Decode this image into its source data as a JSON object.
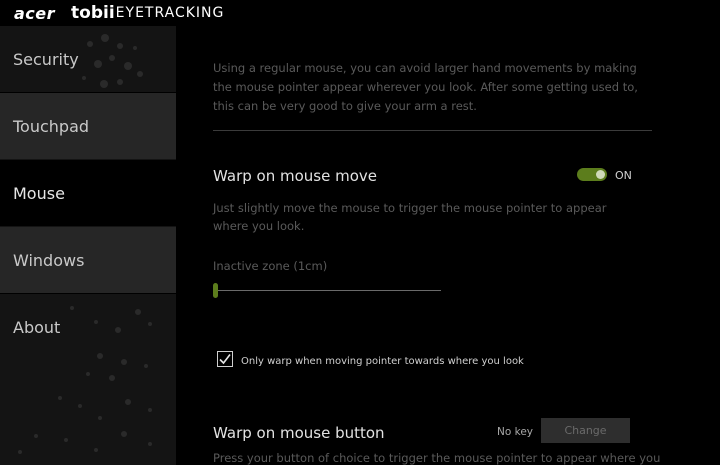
{
  "titlebar": {
    "brand_acer": "acer",
    "brand_tobii": "tobii",
    "brand_eyetracking": "EYETRACKING"
  },
  "sidebar": {
    "items": [
      {
        "label": "Security"
      },
      {
        "label": "Touchpad"
      },
      {
        "label": "Mouse"
      },
      {
        "label": "Windows"
      },
      {
        "label": "About"
      }
    ],
    "active": "Mouse"
  },
  "content": {
    "intro": "Using a regular mouse, you can avoid larger hand movements by making the mouse pointer appear wherever you look. After some getting used to, this can be very good to give your arm a rest.",
    "warp_move": {
      "title": "Warp on mouse move",
      "toggle_label": "ON",
      "toggle_on": true,
      "description": "Just slightly move the mouse to trigger the mouse pointer to appear where you look.",
      "zone_label": "Inactive zone (1cm)",
      "zone_value_fraction": 0.0
    },
    "only_warp": {
      "label": "Only warp when moving pointer towards where you look",
      "checked": true
    },
    "warp_button": {
      "title": "Warp on mouse button",
      "key_value": "No key",
      "change_label": "Change",
      "description": "Press your button of choice to trigger the mouse pointer to appear where you"
    }
  },
  "colors": {
    "accent": "#5c7d1c",
    "background": "#000000",
    "sidebar": "#141414"
  }
}
